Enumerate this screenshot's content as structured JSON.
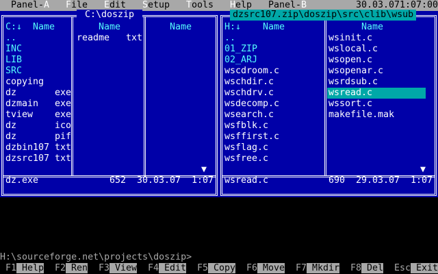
{
  "menubar": {
    "items": [
      {
        "pre": "Panel-",
        "hot": "A",
        "post": ""
      },
      {
        "pre": "",
        "hot": "F",
        "post": "ile"
      },
      {
        "pre": "",
        "hot": "E",
        "post": "dit"
      },
      {
        "pre": "",
        "hot": "S",
        "post": "etup"
      },
      {
        "pre": "",
        "hot": "T",
        "post": "ools"
      },
      {
        "pre": "",
        "hot": "H",
        "post": "elp"
      },
      {
        "pre": "Panel-",
        "hot": "B",
        "post": ""
      }
    ],
    "date": "30.03.07",
    "time": "1:07:00"
  },
  "left_panel": {
    "title": " C:\\doszip ",
    "sort_indicator": "C:↓",
    "col_name": "Name",
    "col1": [
      {
        "name": "..",
        "ext": "",
        "type": "dir"
      },
      {
        "name": "INC",
        "ext": "",
        "type": "dir"
      },
      {
        "name": "LIB",
        "ext": "",
        "type": "dir"
      },
      {
        "name": "SRC",
        "ext": "",
        "type": "dir"
      },
      {
        "name": "copying",
        "ext": "",
        "type": "file"
      },
      {
        "name": "dz",
        "ext": "exe",
        "type": "file"
      },
      {
        "name": "dzmain",
        "ext": "exe",
        "type": "file"
      },
      {
        "name": "tview",
        "ext": "exe",
        "type": "file"
      },
      {
        "name": "dz",
        "ext": "ico",
        "type": "file"
      },
      {
        "name": "dz",
        "ext": "pif",
        "type": "file"
      },
      {
        "name": "dzbin107",
        "ext": "txt",
        "type": "file"
      },
      {
        "name": "dzsrc107",
        "ext": "txt",
        "type": "file"
      }
    ],
    "col2": [
      {
        "name": "readme",
        "ext": "txt",
        "type": "file"
      }
    ],
    "status": {
      "name": "dz.exe",
      "size": "652",
      "date": "30.03.07",
      "time": "1:07"
    }
  },
  "right_panel": {
    "title": "dzsrc107.zip\\doszip\\src\\clib\\wsub",
    "sort_indicator": "H:↓",
    "col_name": "Name",
    "col1": [
      {
        "name": "..",
        "type": "dir"
      },
      {
        "name": "01_ZIP",
        "type": "dir"
      },
      {
        "name": "02_ARJ",
        "type": "dir"
      },
      {
        "name": "wscdroom.c",
        "type": "file"
      },
      {
        "name": "wschdir.c",
        "type": "file"
      },
      {
        "name": "wschdrv.c",
        "type": "file"
      },
      {
        "name": "wsdecomp.c",
        "type": "file"
      },
      {
        "name": "wsearch.c",
        "type": "file"
      },
      {
        "name": "wsfblk.c",
        "type": "file"
      },
      {
        "name": "wsffirst.c",
        "type": "file"
      },
      {
        "name": "wsflag.c",
        "type": "file"
      },
      {
        "name": "wsfree.c",
        "type": "file"
      }
    ],
    "col2": [
      {
        "name": "wsinit.c",
        "type": "file",
        "selected": false
      },
      {
        "name": "wslocal.c",
        "type": "file",
        "selected": false
      },
      {
        "name": "wsopen.c",
        "type": "file",
        "selected": false
      },
      {
        "name": "wsopenar.c",
        "type": "file",
        "selected": false
      },
      {
        "name": "wsrdsub.c",
        "type": "file",
        "selected": false
      },
      {
        "name": "wsread.c",
        "type": "file",
        "selected": true
      },
      {
        "name": "wssort.c",
        "type": "file",
        "selected": false
      },
      {
        "name": "makefile.mak",
        "type": "file",
        "selected": false
      }
    ],
    "status": {
      "name": "wsread.c",
      "size": "690",
      "date": "29.03.07",
      "time": "1:07"
    }
  },
  "command_line": "H:\\sourceforge.net\\projects\\doszip>",
  "keybar": [
    {
      "num": "F1",
      "label": " Help"
    },
    {
      "num": "F2",
      "label": " Ren"
    },
    {
      "num": "F3",
      "label": " View"
    },
    {
      "num": "F4",
      "label": " Edit"
    },
    {
      "num": "F5",
      "label": " Copy"
    },
    {
      "num": "F6",
      "label": " Move"
    },
    {
      "num": "F7",
      "label": " Mkdir"
    },
    {
      "num": "F8",
      "label": " Del"
    },
    {
      "num": "Esc",
      "label": " Exit"
    }
  ],
  "colors": {
    "panel_bg": "#0000a8",
    "dir": "#54fcfc",
    "selection": "#00a8a8",
    "menubar": "#a8a8a8"
  }
}
